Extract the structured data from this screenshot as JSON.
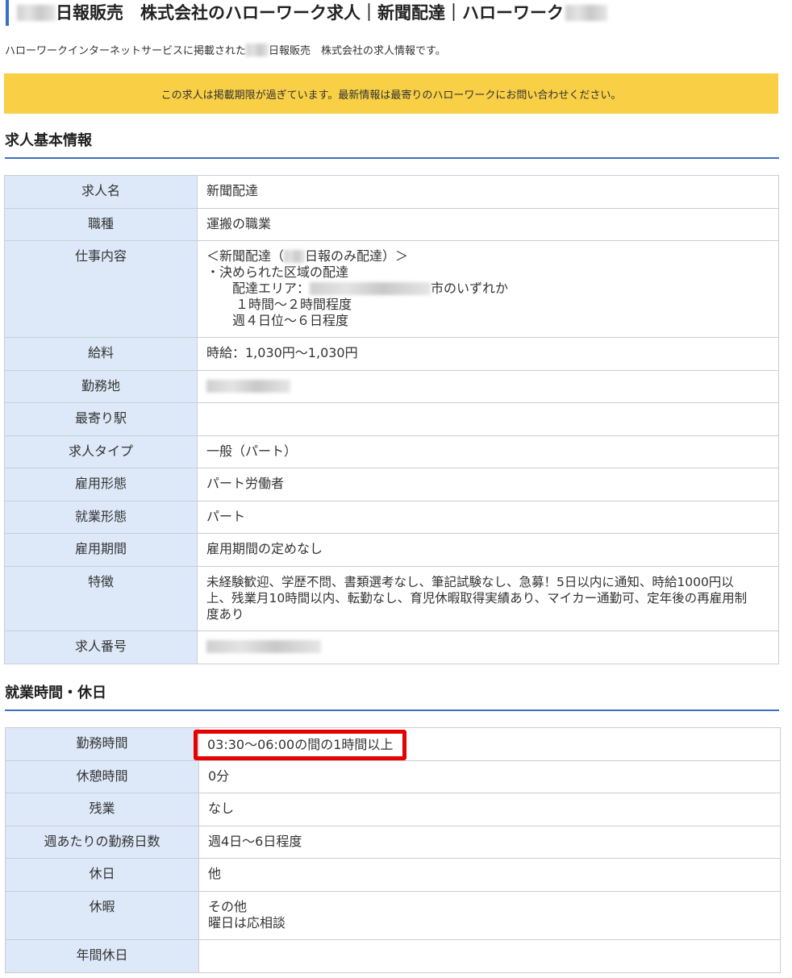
{
  "page": {
    "title_suffix": "日報販売　株式会社のハローワーク求人｜新聞配達｜ハローワーク",
    "subtitle_prefix": "ハローワークインターネットサービスに掲載された",
    "subtitle_suffix": "日報販売　株式会社の求人情報です。",
    "notice": "この求人は掲載期限が過ぎています。最新情報は最寄りのハローワークにお問い合わせください。"
  },
  "basic": {
    "heading": "求人基本情報",
    "rows": {
      "name": {
        "label": "求人名",
        "value": "新聞配達"
      },
      "occupation": {
        "label": "職種",
        "value": "運搬の職業"
      },
      "description": {
        "label": "仕事内容",
        "line1_pre": "＜新聞配達（",
        "line1_post": "日報のみ配達）＞",
        "line2": "・決められた区域の配達",
        "line3_pre": "配達エリア：",
        "line3_post": "市のいずれか",
        "line4": "１時間～２時間程度",
        "line5": "週４日位～６日程度"
      },
      "salary": {
        "label": "給料",
        "value": "時給：1,030円～1,030円"
      },
      "location": {
        "label": "勤務地",
        "value": ""
      },
      "station": {
        "label": "最寄り駅",
        "value": ""
      },
      "job_type": {
        "label": "求人タイプ",
        "value": "一般（パート）"
      },
      "employment_type": {
        "label": "雇用形態",
        "value": "パート労働者"
      },
      "work_form": {
        "label": "就業形態",
        "value": "パート"
      },
      "period": {
        "label": "雇用期間",
        "value": "雇用期間の定めなし"
      },
      "features": {
        "label": "特徴",
        "line1": "未経験歓迎、学歴不問、書類選考なし、筆記試験なし、急募！5日以内に通知、時給1000円以",
        "line2": "上、残業月10時間以内、転勤なし、育児休暇取得実績あり、マイカー通勤可、定年後の再雇用制",
        "line3": "度あり"
      },
      "number": {
        "label": "求人番号",
        "value": ""
      }
    }
  },
  "hours": {
    "heading": "就業時間・休日",
    "rows": {
      "work_hours": {
        "label": "勤務時間",
        "value": "03:30～06:00の間の1時間以上"
      },
      "break": {
        "label": "休憩時間",
        "value": "0分"
      },
      "overtime": {
        "label": "残業",
        "value": "なし"
      },
      "days_per_week": {
        "label": "週あたりの勤務日数",
        "value": "週4日～6日程度"
      },
      "holiday": {
        "label": "休日",
        "value": "他"
      },
      "leave": {
        "label": "休暇",
        "line1": "その他",
        "line2": "曜日は応相談"
      },
      "annual_holidays": {
        "label": "年間休日",
        "value": ""
      }
    }
  },
  "colors": {
    "accent": "#3a6fc4",
    "notice_bg": "#f8cf45",
    "label_bg": "#dde9f8",
    "highlight": "#e60000"
  }
}
